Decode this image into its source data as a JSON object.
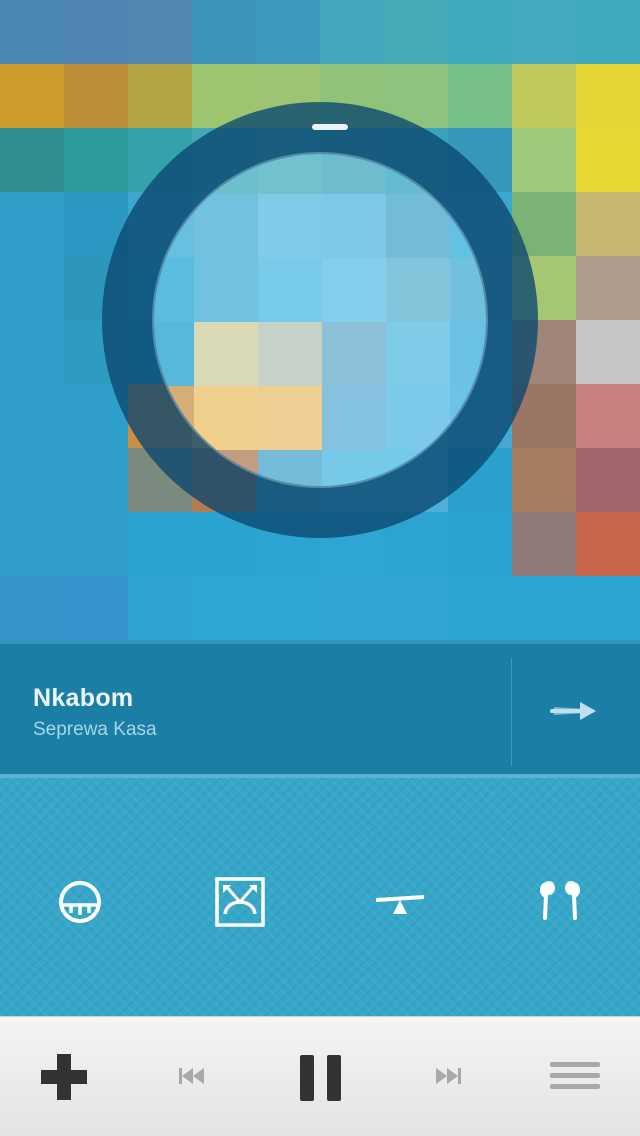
{
  "artwork": {
    "tiles": [
      [
        "#4d88b5",
        "#5285b3",
        "#5587b3",
        "#3e93bb",
        "#3e99bf",
        "#45a7bc",
        "#47aab9",
        "#3fa9be",
        "#43abbd",
        "#3ea9bd"
      ],
      [
        "#cd9a2d",
        "#b98e35",
        "#b2a440",
        "#9dc56e",
        "#9ec373",
        "#8fc37a",
        "#8dc37d",
        "#78c08a",
        "#bfc95a",
        "#e6d534"
      ],
      [
        "#318f90",
        "#2d9b9d",
        "#35a1ab",
        "#43a7b4",
        "#4aa8b6",
        "#45a4b6",
        "#3aa2b9",
        "#3597ba",
        "#9fc87b",
        "#e9d736"
      ],
      [
        "#2e9dc9",
        "#2b98c3",
        "#3ea5cc",
        "#49a9ca",
        "#5ab2d2",
        "#56b1d2",
        "#4ba1c2",
        "#38a8cf",
        "#7ab475",
        "#c5b670"
      ],
      [
        "#2e9fca",
        "#2d96bb",
        "#2ea2cc",
        "#49a9ca",
        "#50b2d5",
        "#5bb7d6",
        "#5eadc4",
        "#4aa6c8",
        "#a5c773",
        "#ae9d8f"
      ],
      [
        "#2e9fcb",
        "#2d9bc2",
        "#2b9fc8",
        "#c9bf8f",
        "#b0b7a8",
        "#6aa6c0",
        "#58b3d4",
        "#41a8d0",
        "#9f8678",
        "#c6c5c6"
      ],
      [
        "#2e9fcb",
        "#2e9fca",
        "#c98f45",
        "#f5b65b",
        "#e5b263",
        "#62a8c8",
        "#55b2d6",
        "#45a9d2",
        "#9b7565",
        "#c7807d"
      ],
      [
        "#2e9fcb",
        "#2e9fca",
        "#7b8a7e",
        "#b37d52",
        "#4ea2c2",
        "#4fb0d5",
        "#4cb0d8",
        "#2ba0cc",
        "#a67b60",
        "#a2676c"
      ],
      [
        "#2e9fcb",
        "#2e9fca",
        "#2ba3cf",
        "#2aa3d0",
        "#2ca4d1",
        "#2ea5d2",
        "#2ca3d0",
        "#2aa3d1",
        "#8e7a79",
        "#c9654c"
      ],
      [
        "#3793c9",
        "#3594cc",
        "#2fa4d1",
        "#2fa5d2",
        "#30a6d2",
        "#31a6d3",
        "#30a5d2",
        "#2ea4d1",
        "#2ea4d1",
        "#2ea4d1"
      ]
    ]
  },
  "now_playing": {
    "title": "Nkabom",
    "artist": "Seprewa Kasa"
  },
  "controls": {
    "icons": [
      "gauge-icon",
      "stereo-width-icon",
      "balance-icon",
      "earphones-icon"
    ]
  },
  "toolbar": {
    "icons": [
      "plus-icon",
      "previous-icon",
      "pause-icon",
      "next-icon",
      "menu-icon"
    ]
  },
  "colors": {
    "track_bar": "#1b7fa5",
    "controls_bg": "#36a6c9",
    "dial_ring": "#0a466e",
    "icon_dark": "#333333",
    "icon_light": "#a8a8a8"
  }
}
